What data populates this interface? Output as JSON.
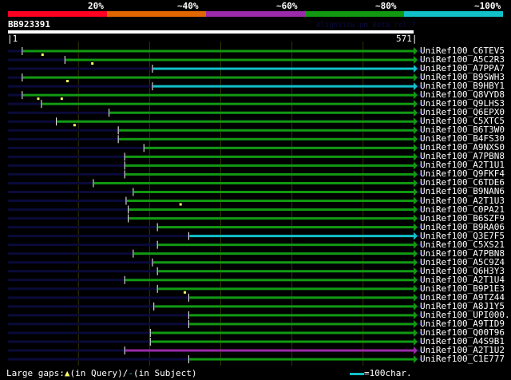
{
  "scale": {
    "labels": [
      "20%",
      "~40%",
      "~60%",
      "~80%",
      "~100%"
    ],
    "colors": [
      "#ff0022",
      "#e06600",
      "#9a2aa8",
      "#119a11",
      "#11c0c8"
    ]
  },
  "query": {
    "name": "BB923391",
    "start_label": "|1",
    "end_label": "571|",
    "length": 571,
    "watermark": "AlignView.pm Beta rel.7"
  },
  "grid_positions": [
    100,
    200,
    300,
    400,
    500
  ],
  "hits": [
    {
      "name": "UniRef100_C6TEV5",
      "start": 21,
      "color": "green",
      "gaps_query": [
        49
      ]
    },
    {
      "name": "UniRef100_A5C2R3",
      "start": 81,
      "color": "green",
      "gaps_query": [
        119
      ]
    },
    {
      "name": "UniRef100_A7PPA7",
      "start": 204,
      "color": "cyan",
      "gaps_query": []
    },
    {
      "name": "UniRef100_B9SWH3",
      "start": 21,
      "color": "green",
      "gaps_query": [
        84
      ]
    },
    {
      "name": "UniRef100_B9HBY1",
      "start": 204,
      "color": "cyan",
      "gaps_query": []
    },
    {
      "name": "UniRef100_Q8VYD8",
      "start": 21,
      "color": "green",
      "gaps_query": [
        43,
        76
      ]
    },
    {
      "name": "UniRef100_Q9LHS3",
      "start": 48,
      "color": "green",
      "gaps_query": []
    },
    {
      "name": "UniRef100_Q6EPX0",
      "start": 143,
      "color": "green",
      "gaps_query": []
    },
    {
      "name": "UniRef100_C5XTC5",
      "start": 69,
      "color": "green",
      "gaps_query": [
        94
      ]
    },
    {
      "name": "UniRef100_B6T3W0",
      "start": 156,
      "color": "green",
      "gaps_query": []
    },
    {
      "name": "UniRef100_B4FS30",
      "start": 156,
      "color": "green",
      "gaps_query": []
    },
    {
      "name": "UniRef100_A9NXS0",
      "start": 192,
      "color": "green",
      "gaps_query": []
    },
    {
      "name": "UniRef100_A7PBN8",
      "start": 165,
      "color": "green",
      "gaps_query": []
    },
    {
      "name": "UniRef100_A2T1U1",
      "start": 165,
      "color": "green",
      "gaps_query": []
    },
    {
      "name": "UniRef100_Q9FKF4",
      "start": 165,
      "color": "green",
      "gaps_query": []
    },
    {
      "name": "UniRef100_C6TDE6",
      "start": 121,
      "color": "green",
      "gaps_query": []
    },
    {
      "name": "UniRef100_B9NAN6",
      "start": 177,
      "color": "green",
      "gaps_query": []
    },
    {
      "name": "UniRef100_A2T1U3",
      "start": 167,
      "color": "green",
      "gaps_query": [
        243
      ]
    },
    {
      "name": "UniRef100_C0PA21",
      "start": 170,
      "color": "green",
      "gaps_query": []
    },
    {
      "name": "UniRef100_B6SZF9",
      "start": 170,
      "color": "green",
      "gaps_query": []
    },
    {
      "name": "UniRef100_B9RA06",
      "start": 211,
      "color": "green",
      "gaps_query": []
    },
    {
      "name": "UniRef100_Q3E7F5",
      "start": 255,
      "color": "cyan",
      "gaps_query": []
    },
    {
      "name": "UniRef100_C5XS21",
      "start": 211,
      "color": "green",
      "gaps_query": []
    },
    {
      "name": "UniRef100_A7PBN8",
      "start": 177,
      "color": "green",
      "gaps_query": []
    },
    {
      "name": "UniRef100_A5C9Z4",
      "start": 204,
      "color": "green",
      "gaps_query": []
    },
    {
      "name": "UniRef100_Q6H3Y3",
      "start": 211,
      "color": "green",
      "gaps_query": []
    },
    {
      "name": "UniRef100_A2T1U4",
      "start": 165,
      "color": "green",
      "gaps_query": []
    },
    {
      "name": "UniRef100_B9P1E3",
      "start": 211,
      "color": "green",
      "gaps_query": [
        249
      ]
    },
    {
      "name": "UniRef100_A9TZ44",
      "start": 255,
      "color": "green",
      "gaps_query": []
    },
    {
      "name": "UniRef100_A8J1Y5",
      "start": 206,
      "color": "green",
      "gaps_query": []
    },
    {
      "name": "UniRef100_UPI000..",
      "start": 255,
      "color": "green",
      "gaps_query": []
    },
    {
      "name": "UniRef100_A9TID9",
      "start": 255,
      "color": "green",
      "gaps_query": []
    },
    {
      "name": "UniRef100_Q00T96",
      "start": 201,
      "color": "green",
      "gaps_query": []
    },
    {
      "name": "UniRef100_A4S9B1",
      "start": 201,
      "color": "green",
      "gaps_query": []
    },
    {
      "name": "UniRef100_A2T1U2",
      "start": 165,
      "color": "magenta",
      "gaps_query": []
    },
    {
      "name": "UniRef100_C1E777",
      "start": 255,
      "color": "green",
      "gaps_query": []
    }
  ],
  "colors": {
    "green": "#119a11",
    "cyan": "#11c0c8",
    "magenta": "#9a2aa8",
    "query_bg": "#0a0a3a",
    "gap_query": "#ffff66",
    "grid": "#333300"
  },
  "legend": {
    "prefix": "Large gaps:",
    "query_text": "(in Query)/",
    "subject_text": "(in Subject)",
    "scale_text": "=100char."
  }
}
